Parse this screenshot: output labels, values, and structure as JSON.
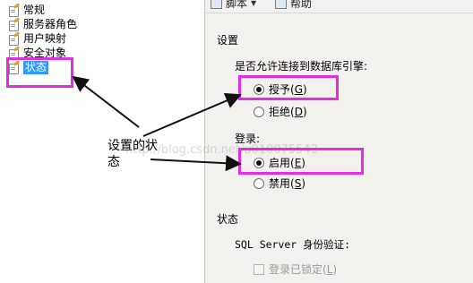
{
  "nav": {
    "items": [
      {
        "label": "常规",
        "selected": false
      },
      {
        "label": "服务器角色",
        "selected": false
      },
      {
        "label": "用户映射",
        "selected": false
      },
      {
        "label": "安全对象",
        "selected": false
      },
      {
        "label": "状态",
        "selected": true
      }
    ]
  },
  "toolbar": {
    "script_label": "脚本",
    "help_label": "帮助"
  },
  "settings": {
    "heading": "设置",
    "permission_question": "是否允许连接到数据库引擎:",
    "permission_options": [
      {
        "label": "授予",
        "hotkey": "G",
        "selected": true
      },
      {
        "label": "拒绝",
        "hotkey": "D",
        "selected": false
      }
    ],
    "login_label": "登录:",
    "login_options": [
      {
        "label": "启用",
        "hotkey": "E",
        "selected": true
      },
      {
        "label": "禁用",
        "hotkey": "S",
        "selected": false
      }
    ]
  },
  "status": {
    "heading": "状态",
    "auth_label": "SQL Server 身份验证:",
    "locked_label": "登录已锁定",
    "locked_hotkey": "L",
    "locked_checked": false,
    "locked_enabled": false
  },
  "annotation": {
    "callout_line1": "设置的状",
    "callout_line2": "态",
    "highlight_color": "#e22ee2"
  },
  "watermark": "http://blog.csdn.net/u010075543"
}
